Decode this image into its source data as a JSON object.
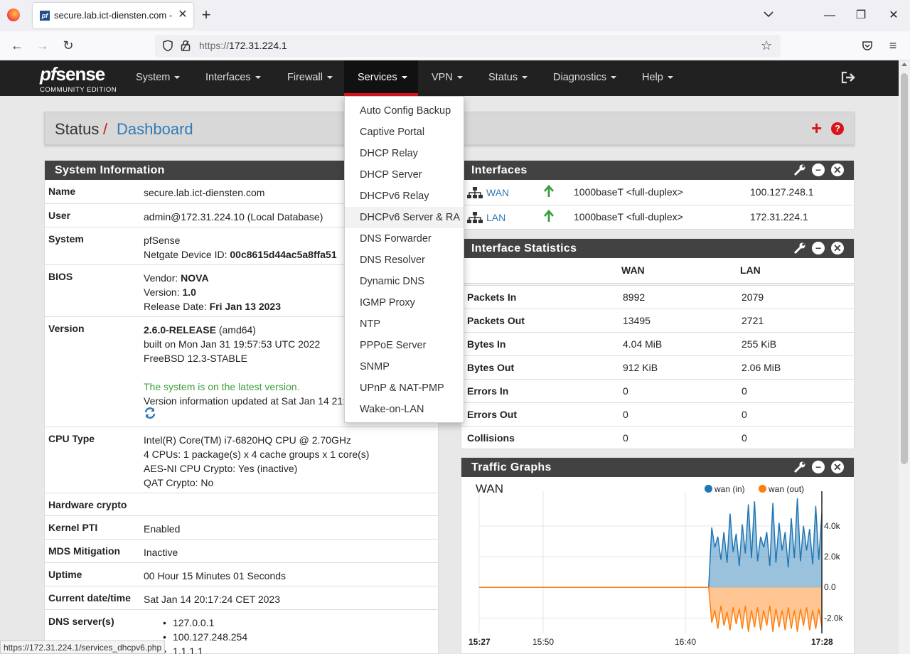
{
  "browser": {
    "tab_title": "secure.lab.ict-diensten.com - Status: Dashboard",
    "tab_favicon_letter": "pf",
    "new_tab": "+",
    "url_prefix": "https://",
    "url_host": "172.31.224.1",
    "win_minimize": "—",
    "win_restore": "❐",
    "win_close": "✕",
    "status_url": "https://172.31.224.1/services_dhcpv6.php"
  },
  "pfsense": {
    "logo_word": "sense",
    "logo_pf": "pf",
    "logo_edition": "COMMUNITY EDITION",
    "menu": [
      "System",
      "Interfaces",
      "Firewall",
      "Services",
      "VPN",
      "Status",
      "Diagnostics",
      "Help"
    ],
    "active_menu": "Services"
  },
  "breadcrumb": {
    "section": "Status",
    "separator": "/",
    "page": "Dashboard",
    "add_icon": "+",
    "help_icon": "?"
  },
  "services_dropdown": [
    "Auto Config Backup",
    "Captive Portal",
    "DHCP Relay",
    "DHCP Server",
    "DHCPv6 Relay",
    "DHCPv6 Server & RA",
    "DNS Forwarder",
    "DNS Resolver",
    "Dynamic DNS",
    "IGMP Proxy",
    "NTP",
    "PPPoE Server",
    "SNMP",
    "UPnP & NAT-PMP",
    "Wake-on-LAN"
  ],
  "hovered_service": "DHCPv6 Server & RA",
  "system_information": {
    "title": "System Information",
    "name_label": "Name",
    "name": "secure.lab.ict-diensten.com",
    "user_label": "User",
    "user": "admin@172.31.224.10 (Local Database)",
    "system_label": "System",
    "system": "pfSense",
    "device_id_prefix": "Netgate Device ID: ",
    "device_id": "00c8615d44ac5a8ffa51",
    "bios_label": "BIOS",
    "bios_vendor_prefix": "Vendor: ",
    "bios_vendor": "NOVA",
    "bios_version_prefix": "Version: ",
    "bios_version": "1.0",
    "bios_date_prefix": "Release Date: ",
    "bios_date": "Fri Jan 13 2023",
    "version_label": "Version",
    "version": "2.6.0-RELEASE",
    "version_arch": " (amd64)",
    "version_built": "built on Mon Jan 31 19:57:53 UTC 2022",
    "version_os": "FreeBSD 12.3-STABLE",
    "version_status": "The system is on the latest version.",
    "version_updated": "Version information updated at Sat Jan 14 21:",
    "cpu_label": "CPU Type",
    "cpu_model": "Intel(R) Core(TM) i7-6820HQ CPU @ 2.70GHz",
    "cpu_count": "4 CPUs: 1 package(s) x 4 cache groups x 1 core(s)",
    "cpu_aesni": "AES-NI CPU Crypto: Yes (inactive)",
    "cpu_qat": "QAT Crypto: No",
    "hwcrypto_label": "Hardware crypto",
    "kpti_label": "Kernel PTI",
    "kpti": "Enabled",
    "mds_label": "MDS Mitigation",
    "mds": "Inactive",
    "uptime_label": "Uptime",
    "uptime": "00 Hour 15 Minutes 01 Seconds",
    "datetime_label": "Current date/time",
    "datetime": "Sat Jan 14 20:17:24 CET 2023",
    "dns_label": "DNS server(s)",
    "dns": [
      "127.0.0.1",
      "100.127.248.254",
      "1.1.1.1"
    ]
  },
  "interfaces": {
    "title": "Interfaces",
    "rows": [
      {
        "name": "WAN",
        "media": "1000baseT <full-duplex>",
        "ip": "100.127.248.1"
      },
      {
        "name": "LAN",
        "media": "1000baseT <full-duplex>",
        "ip": "172.31.224.1"
      }
    ]
  },
  "interface_statistics": {
    "title": "Interface Statistics",
    "columns": [
      "WAN",
      "LAN"
    ],
    "rows": [
      {
        "label": "Packets In",
        "wan": "8992",
        "lan": "2079"
      },
      {
        "label": "Packets Out",
        "wan": "13495",
        "lan": "2721"
      },
      {
        "label": "Bytes In",
        "wan": "4.04 MiB",
        "lan": "255 KiB"
      },
      {
        "label": "Bytes Out",
        "wan": "912 KiB",
        "lan": "2.06 MiB"
      },
      {
        "label": "Errors In",
        "wan": "0",
        "lan": "0"
      },
      {
        "label": "Errors Out",
        "wan": "0",
        "lan": "0"
      },
      {
        "label": "Collisions",
        "wan": "0",
        "lan": "0"
      }
    ]
  },
  "traffic_graphs": {
    "title": "Traffic Graphs",
    "graph_title": "WAN",
    "legend": [
      "wan (in)",
      "wan (out)"
    ],
    "colors": {
      "in": "#1f77b4",
      "out": "#ff7f0e"
    }
  },
  "chart_data": {
    "type": "area",
    "title": "WAN",
    "x_ticks": [
      "15:27",
      "15:50",
      "16:40",
      "17:28"
    ],
    "y_ticks": [
      "4.0k",
      "2.0k",
      "0.0",
      "-2.0k"
    ],
    "ylim": [
      -3000,
      5800
    ],
    "grid": true,
    "legend_position": "top-right",
    "series": [
      {
        "name": "wan (in)",
        "color": "#1f77b4",
        "values": [
          0,
          0,
          0,
          0,
          0,
          0,
          0,
          0,
          0,
          0,
          0,
          0,
          0,
          0,
          0,
          0,
          0,
          0,
          0,
          0,
          0,
          0,
          0,
          0,
          0,
          0,
          0,
          0,
          0,
          0,
          0,
          0,
          0,
          0,
          0,
          0,
          0,
          0,
          0,
          0,
          0,
          0,
          0,
          0,
          0,
          0,
          0,
          0,
          0,
          0,
          0,
          0,
          0,
          0,
          0,
          0,
          0,
          0,
          0,
          0,
          0,
          0,
          0,
          0,
          0,
          0,
          0,
          0,
          0,
          0,
          0,
          0,
          0,
          0,
          0,
          0,
          3900,
          2600,
          3300,
          1800,
          3600,
          1600,
          4800,
          2300,
          3500,
          1400,
          4100,
          2200,
          5400,
          1900,
          5600,
          1700,
          3300,
          2600,
          3600,
          1400,
          5500,
          1600,
          4200,
          2400,
          3600,
          1300,
          4500,
          1900,
          5800,
          1700,
          4000,
          2400,
          3800,
          1500,
          5300,
          1800,
          4800
        ]
      },
      {
        "name": "wan (out)",
        "color": "#ff7f0e",
        "values": [
          0,
          0,
          0,
          0,
          0,
          0,
          0,
          0,
          0,
          0,
          0,
          0,
          0,
          0,
          0,
          0,
          0,
          0,
          0,
          0,
          0,
          0,
          0,
          0,
          0,
          0,
          0,
          0,
          0,
          0,
          0,
          0,
          0,
          0,
          0,
          0,
          0,
          0,
          0,
          0,
          0,
          0,
          0,
          0,
          0,
          0,
          0,
          0,
          0,
          0,
          0,
          0,
          0,
          0,
          0,
          0,
          0,
          0,
          0,
          0,
          0,
          0,
          0,
          0,
          0,
          0,
          0,
          0,
          0,
          0,
          0,
          0,
          0,
          0,
          0,
          0,
          -2300,
          -1500,
          -2700,
          -1200,
          -2500,
          -1600,
          -2800,
          -1300,
          -2400,
          -1400,
          -2700,
          -1200,
          -2900,
          -1500,
          -2600,
          -1300,
          -2800,
          -1500,
          -2500,
          -1200,
          -2900,
          -1400,
          -2600,
          -1500,
          -2800,
          -1300,
          -2700,
          -1500,
          -2900,
          -1400,
          -2500,
          -1300,
          -2800,
          -1500,
          -2700,
          -1400,
          -2600
        ]
      }
    ]
  }
}
